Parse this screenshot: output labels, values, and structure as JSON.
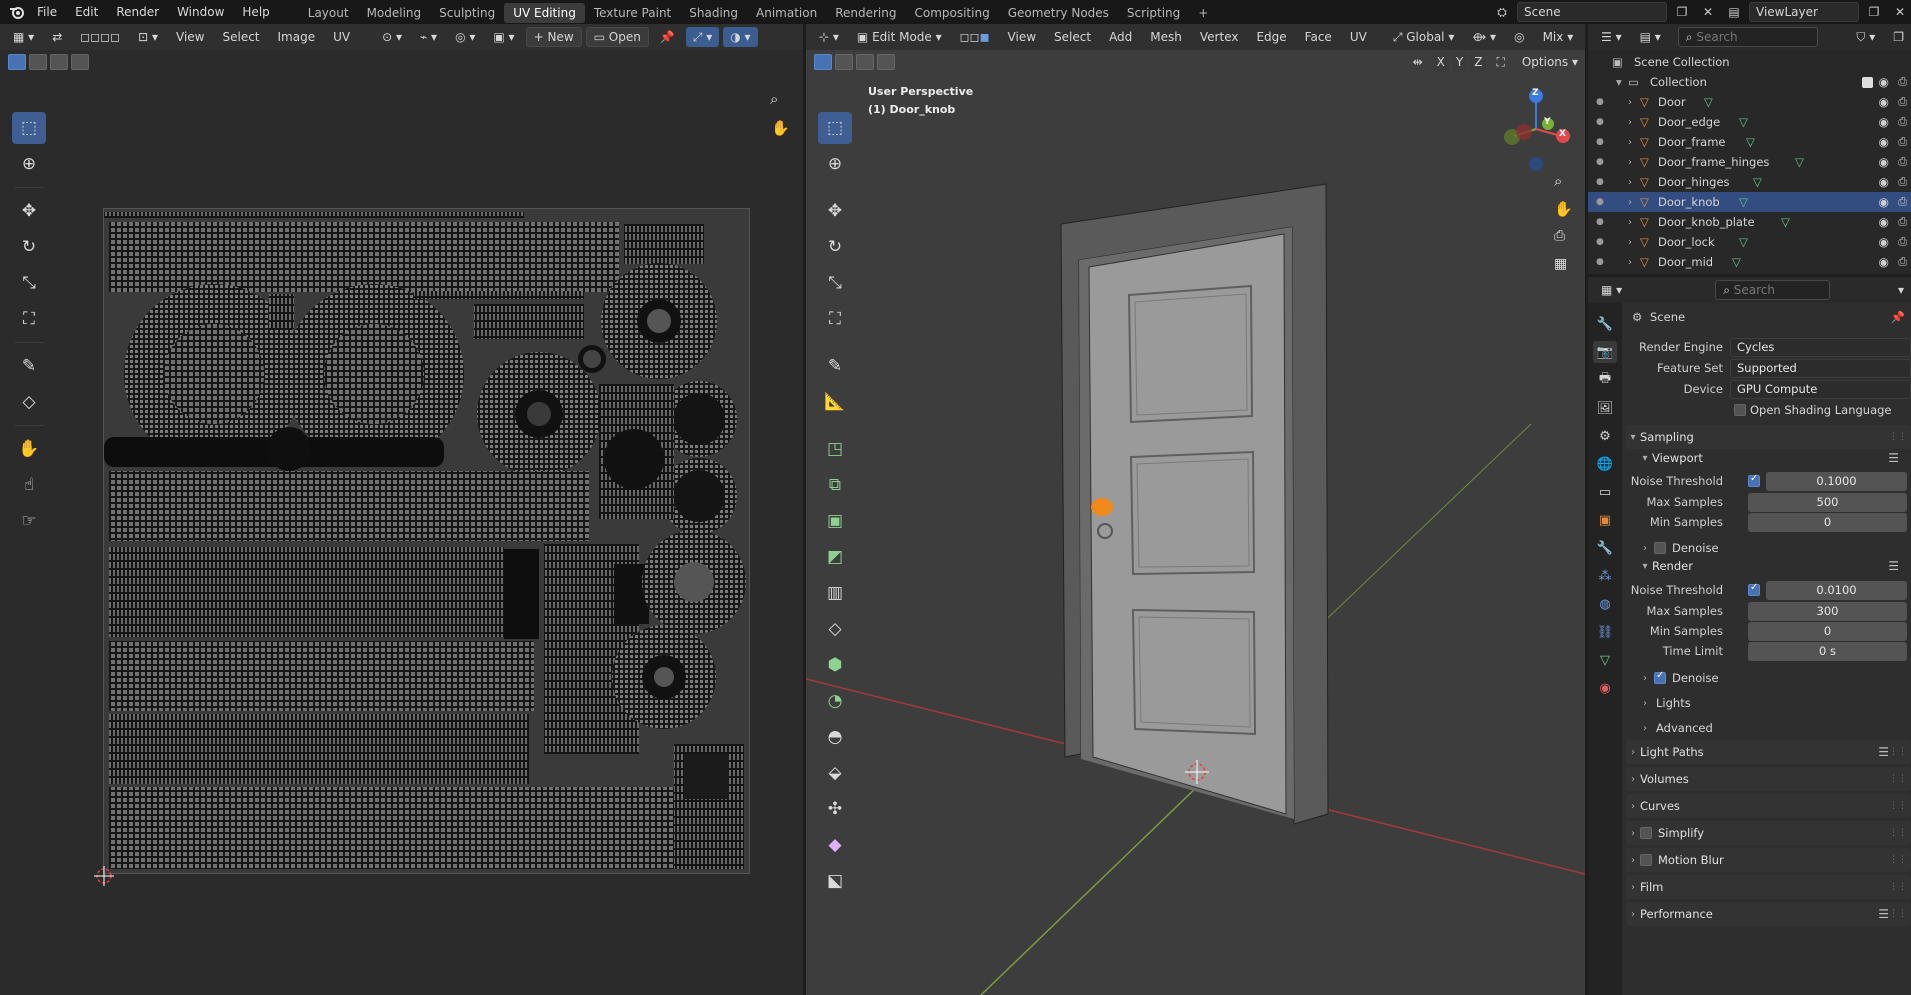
{
  "menubar": {
    "items": [
      "File",
      "Edit",
      "Render",
      "Window",
      "Help"
    ],
    "workspaces": [
      "Layout",
      "Modeling",
      "Sculpting",
      "UV Editing",
      "Texture Paint",
      "Shading",
      "Animation",
      "Rendering",
      "Compositing",
      "Geometry Nodes",
      "Scripting"
    ],
    "active_workspace": "UV Editing",
    "add_tab": "+",
    "scene_name": "Scene",
    "view_layer": "ViewLayer"
  },
  "uv_editor": {
    "header": {
      "view": "View",
      "select": "Select",
      "image": "Image",
      "uv": "UV",
      "new": "New",
      "open": "Open"
    }
  },
  "viewport": {
    "header": {
      "mode": "Edit Mode",
      "view": "View",
      "select": "Select",
      "add": "Add",
      "mesh": "Mesh",
      "vertex": "Vertex",
      "edge": "Edge",
      "face": "Face",
      "uv": "UV",
      "orientation": "Global",
      "shading": "Mix",
      "options": "Options",
      "axes": [
        "X",
        "Y",
        "Z"
      ]
    },
    "perspective_label": "User Perspective",
    "object_label": "(1) Door_knob",
    "gizmo_axes": [
      "Z",
      "Y",
      "X"
    ]
  },
  "outliner": {
    "search_placeholder": "Search",
    "scene_collection": "Scene Collection",
    "collection": "Collection",
    "objects": [
      "Door",
      "Door_edge",
      "Door_frame",
      "Door_frame_hinges",
      "Door_hinges",
      "Door_knob",
      "Door_knob_plate",
      "Door_lock",
      "Door_mid"
    ],
    "selected": "Door_knob"
  },
  "properties": {
    "search_placeholder": "Search",
    "context": "Scene",
    "render_engine_label": "Render Engine",
    "render_engine": "Cycles",
    "feature_set_label": "Feature Set",
    "feature_set": "Supported",
    "device_label": "Device",
    "device": "GPU Compute",
    "osl_label": "Open Shading Language",
    "sampling": "Sampling",
    "viewport": "Viewport",
    "noise_threshold_label": "Noise Threshold",
    "vp_noise_threshold": "0.1000",
    "max_samples_label": "Max Samples",
    "vp_max_samples": "500",
    "min_samples_label": "Min Samples",
    "vp_min_samples": "0",
    "denoise_label": "Denoise",
    "render": "Render",
    "r_noise_threshold": "0.0100",
    "r_max_samples": "300",
    "r_min_samples": "0",
    "time_limit_label": "Time Limit",
    "time_limit": "0 s",
    "lights": "Lights",
    "advanced": "Advanced",
    "light_paths": "Light Paths",
    "volumes": "Volumes",
    "curves": "Curves",
    "simplify": "Simplify",
    "motion_blur": "Motion Blur",
    "film": "Film",
    "performance": "Performance"
  },
  "colors": {
    "accent": "#4772b3",
    "selected_row": "#334d80",
    "knob_highlight": "#f08a1c"
  }
}
